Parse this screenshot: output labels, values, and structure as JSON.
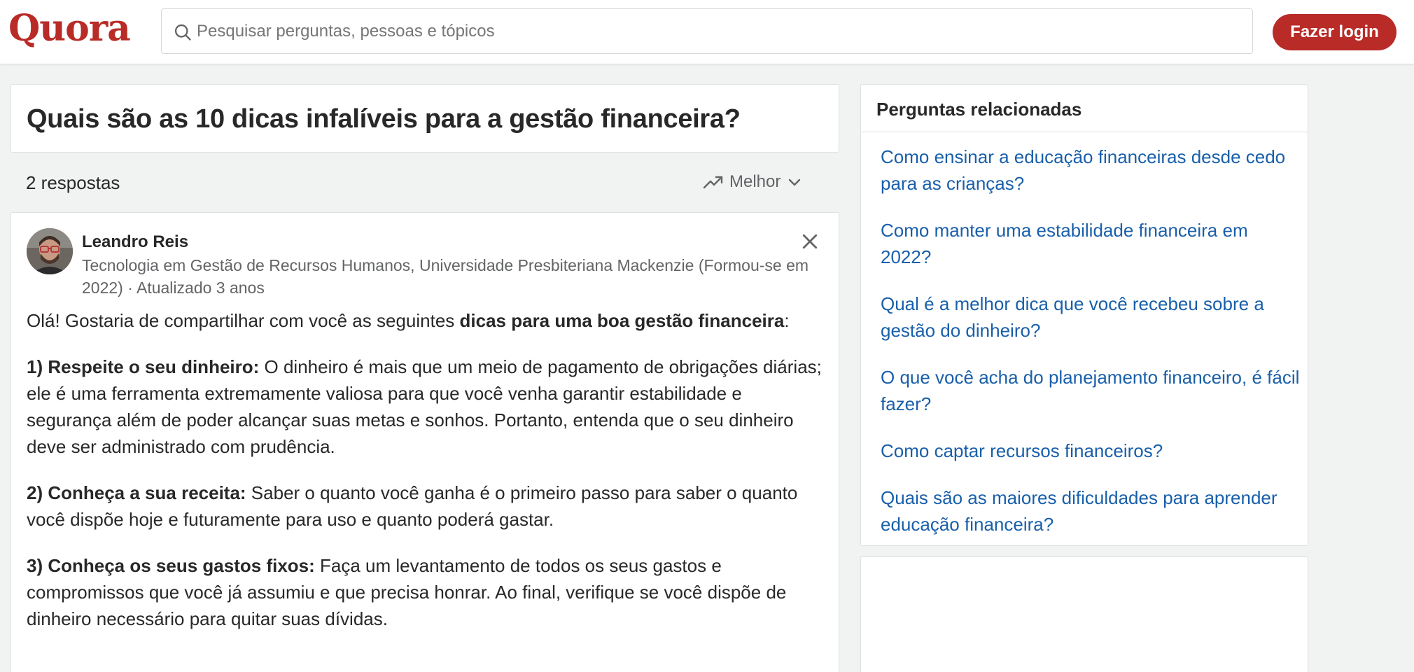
{
  "header": {
    "logo": "Quora",
    "search_placeholder": "Pesquisar perguntas, pessoas e tópicos",
    "login_label": "Fazer login"
  },
  "question": {
    "title": "Quais são as 10 dicas infalíveis para a gestão financeira?"
  },
  "answers": {
    "count_label": "2 respostas",
    "sort_label": "Melhor"
  },
  "answer": {
    "author": "Leandro Reis",
    "credential": "Tecnologia em Gestão de Recursos Humanos, Universidade Presbiteriana Mackenzie (Formou-se em 2022) · Atualizado 3 anos",
    "intro_text": "Olá! Gostaria de compartilhar com você as seguintes ",
    "intro_bold": "dicas para uma boa gestão financeira",
    "intro_end": ":",
    "tips": [
      {
        "heading": "1) Respeite o seu dinheiro:",
        "text": " O dinheiro é mais que um meio de pagamento de obrigações diárias; ele é uma ferramenta extremamente valiosa para que você venha garantir estabilidade e segurança além de poder alcançar suas metas e sonhos. Portanto, entenda que o seu dinheiro deve ser administrado com prudência."
      },
      {
        "heading": "2) Conheça a sua receita:",
        "text": " Saber o quanto você ganha é o primeiro passo para saber o quanto você dispõe hoje e futuramente para uso e quanto poderá gastar."
      },
      {
        "heading": "3) Conheça os seus gastos fixos:",
        "text": " Faça um levantamento de todos os seus gastos e compromissos que você já assumiu e que precisa honrar. Ao final, verifique se você dispõe de dinheiro necessário para quitar suas dívidas."
      }
    ]
  },
  "related": {
    "title": "Perguntas relacionadas",
    "items": [
      "Como ensinar a educação financeiras desde cedo para as crianças?",
      "Como manter uma estabilidade financeira em 2022?",
      "Qual é a melhor dica que você recebeu sobre a gestão do dinheiro?",
      "O que você acha do planejamento financeiro, é fácil fazer?",
      "Como captar recursos financeiros?",
      "Quais são as maiores dificuldades para aprender educação financeira?"
    ]
  },
  "colors": {
    "brand": "#b92b27",
    "link": "#195faa",
    "background": "#f1f2f2"
  },
  "icons": [
    "search-icon",
    "trending-up-icon",
    "chevron-down-icon",
    "close-icon"
  ]
}
